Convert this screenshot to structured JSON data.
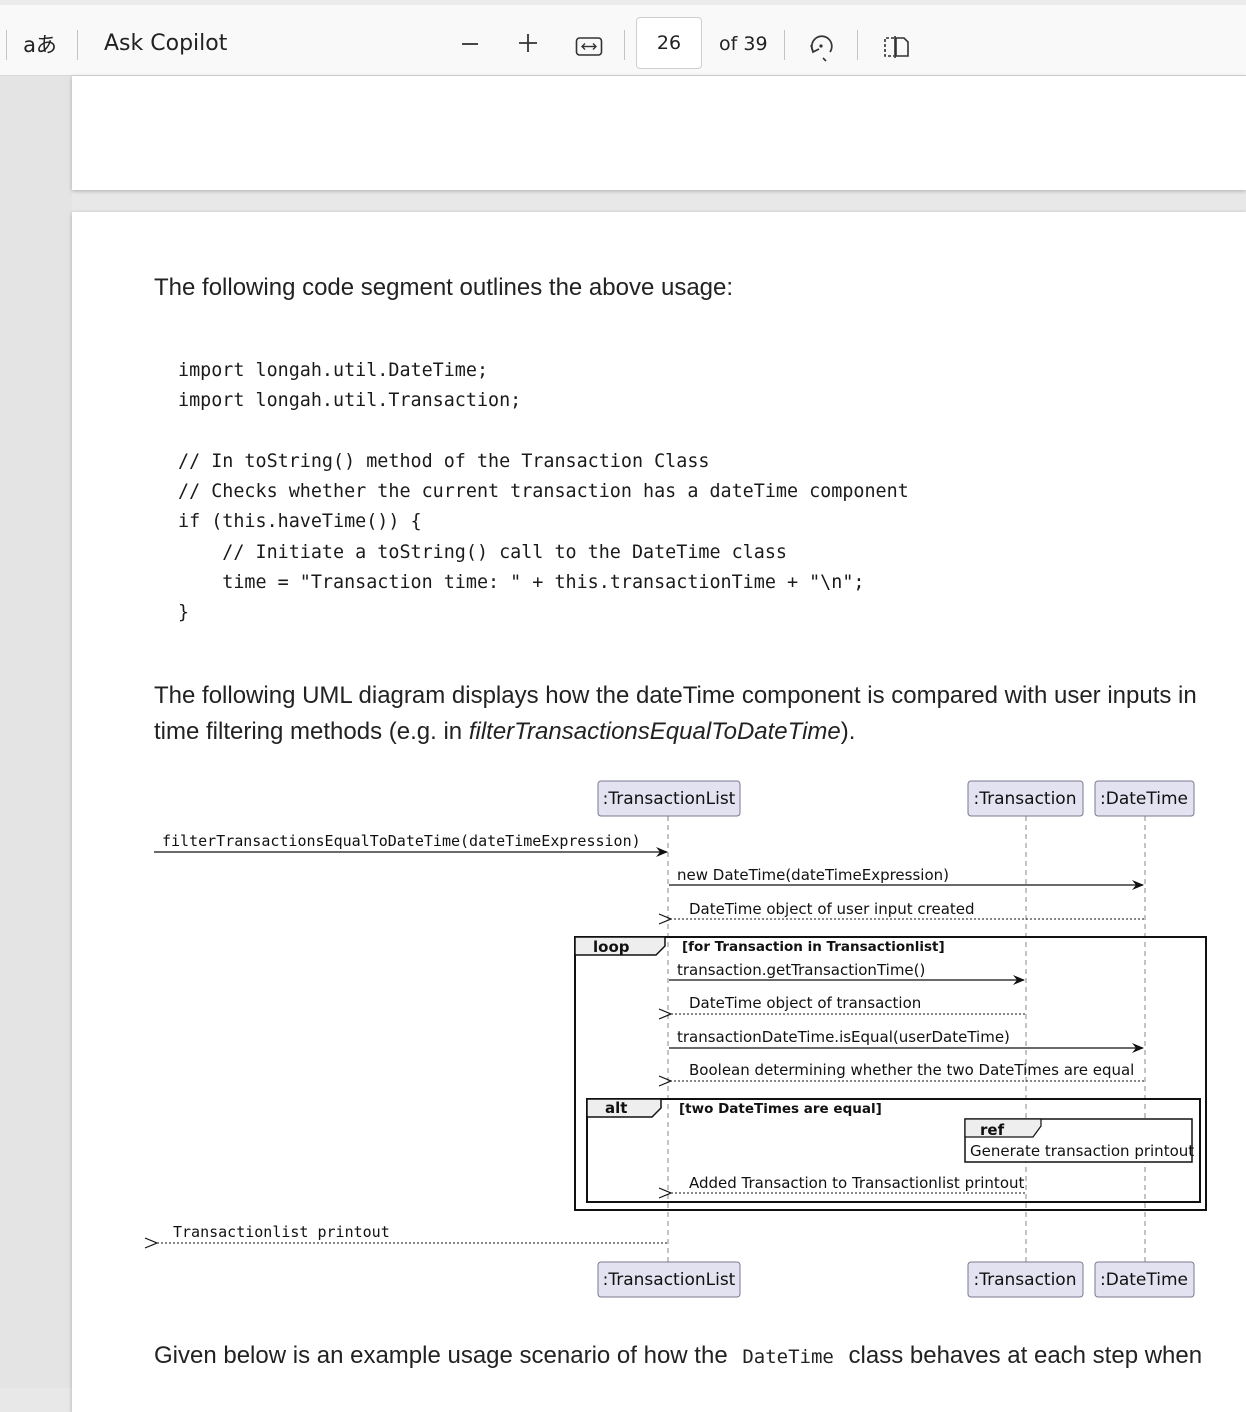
{
  "toolbar": {
    "translate_icon": "aあ",
    "copilot_label": "Ask Copilot",
    "zoom_out_icon": "minus-icon",
    "zoom_in_icon": "plus-icon",
    "fit_width_icon": "fit-width-icon",
    "current_page": "26",
    "total_pages": "of 39",
    "rotate_icon": "rotate-icon",
    "two_page_icon": "two-page-view-icon"
  },
  "content": {
    "intro": "The following code segment outlines the above usage:",
    "code": "import longah.util.DateTime;\nimport longah.util.Transaction;\n\n// In toString() method of the Transaction Class\n// Checks whether the current transaction has a dateTime component\nif (this.haveTime()) {\n    // Initiate a toString() call to the DateTime class\n    time = \"Transaction time: \" + this.transactionTime + \"\\n\";\n}",
    "uml_intro": "The following UML diagram displays how the dateTime component is compared with user inputs in time filtering methods (e.g. in ",
    "uml_intro_method": "filterTransactionsEqualToDateTime",
    "uml_intro_end": ").",
    "bottom_text_before": "Given below is an example usage scenario of how the ",
    "bottom_text_code": "DateTime",
    "bottom_text_after": " class behaves at each step when"
  },
  "diagram": {
    "participants": [
      ":TransactionList",
      ":Transaction",
      ":DateTime"
    ],
    "messages": {
      "m1": "filterTransactionsEqualToDateTime(dateTimeExpression)",
      "m2": "new DateTime(dateTimeExpression)",
      "m3": "DateTime object of user input created",
      "m4": "transaction.getTransactionTime()",
      "m5": "DateTime object of transaction",
      "m6": "transactionDateTime.isEqual(userDateTime)",
      "m7": "Boolean determining whether the two DateTimes are equal",
      "m8": "Added Transaction to Transactionlist printout",
      "m9": "Transactionlist printout"
    },
    "loop": {
      "label": "loop",
      "guard": "[for Transaction in Transactionlist]"
    },
    "alt": {
      "label": "alt",
      "guard": "[two DateTimes are equal]"
    },
    "ref": {
      "label": "ref",
      "text": "Generate transaction printout"
    }
  },
  "colors": {
    "participant_fill": "#e2e2f0",
    "participant_stroke": "#7a7a90",
    "toolbar_bg": "#f9f9f9",
    "page_bg": "#ffffff",
    "gutter_bg": "#e4e4e4"
  }
}
